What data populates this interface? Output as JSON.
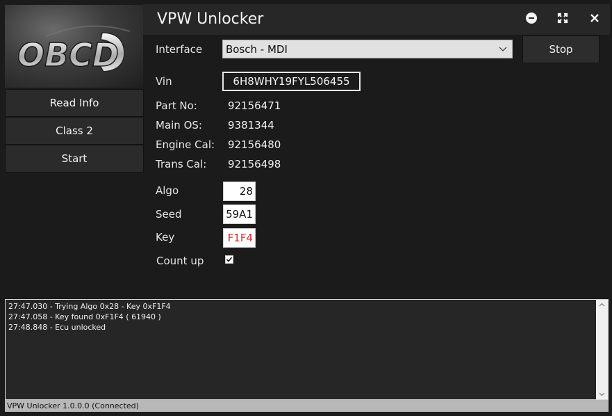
{
  "window": {
    "title": "VPW Unlocker"
  },
  "logo": {
    "text": "OBCD"
  },
  "sidebar": {
    "buttons": [
      "Read Info",
      "Class 2",
      "Start"
    ]
  },
  "form": {
    "interface_label": "Interface",
    "interface_value": "Bosch - MDI",
    "stop_label": "Stop",
    "vin_label": "Vin",
    "vin_value": "6H8WHY19FYL506455",
    "part_no_label": "Part No:",
    "part_no_value": "92156471",
    "main_os_label": "Main OS:",
    "main_os_value": "9381344",
    "engine_cal_label": "Engine Cal:",
    "engine_cal_value": "92156480",
    "trans_cal_label": "Trans Cal:",
    "trans_cal_value": "92156498",
    "algo_label": "Algo",
    "algo_value": "28",
    "seed_label": "Seed",
    "seed_value": "59A1",
    "key_label": "Key",
    "key_value": "F1F4",
    "count_up_label": "Count up",
    "count_up_checked": true
  },
  "log": {
    "lines": [
      "27:47.030 - Trying Algo 0x28 - Key 0xF1F4",
      "27:47.058 - Key found 0xF1F4 ( 61940 )",
      "27:48.848 - Ecu unlocked"
    ]
  },
  "status": {
    "text": "VPW Unlocker  1.0.0.0 (Connected)"
  },
  "colors": {
    "background": "#1b1b1b",
    "key_text": "#d9262c",
    "titlebar": "#272727"
  }
}
